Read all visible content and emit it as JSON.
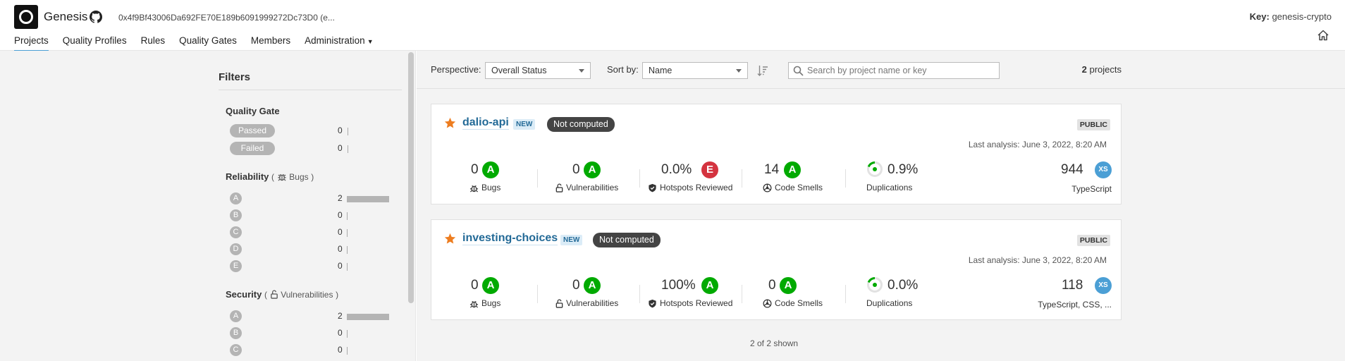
{
  "header": {
    "org_name": "Genesis",
    "org_key_id": "0x4f9Bf43006Da692FE70E189b6091999272Dc73D0 (e...",
    "key_label": "Key:",
    "key_value": "genesis-crypto",
    "icons": [
      "org-logo",
      "github-icon",
      "home-icon"
    ]
  },
  "nav": {
    "items": [
      {
        "label": "Projects",
        "active": true
      },
      {
        "label": "Quality Profiles"
      },
      {
        "label": "Rules"
      },
      {
        "label": "Quality Gates"
      },
      {
        "label": "Members"
      },
      {
        "label": "Administration",
        "has_dropdown": true
      }
    ]
  },
  "filters": {
    "title": "Filters",
    "quality_gate": {
      "title": "Quality Gate",
      "rows": [
        {
          "label": "Passed",
          "count": "0"
        },
        {
          "label": "Failed",
          "count": "0"
        }
      ]
    },
    "reliability": {
      "title": "Reliability",
      "sub_label": "Bugs",
      "rows": [
        {
          "label": "A",
          "count": "2",
          "fraction": 1
        },
        {
          "label": "B",
          "count": "0",
          "fraction": 0
        },
        {
          "label": "C",
          "count": "0",
          "fraction": 0
        },
        {
          "label": "D",
          "count": "0",
          "fraction": 0
        },
        {
          "label": "E",
          "count": "0",
          "fraction": 0
        }
      ]
    },
    "security": {
      "title": "Security",
      "sub_label": "Vulnerabilities",
      "rows": [
        {
          "label": "A",
          "count": "2",
          "fraction": 1
        },
        {
          "label": "B",
          "count": "0",
          "fraction": 0
        },
        {
          "label": "C",
          "count": "0",
          "fraction": 0
        }
      ]
    }
  },
  "toolbar": {
    "perspective_label": "Perspective:",
    "perspective_value": "Overall Status",
    "sort_label": "Sort by:",
    "sort_value": "Name",
    "search_placeholder": "Search by project name or key",
    "count_value": "2",
    "count_suffix": "projects"
  },
  "colors": {
    "rating_A": "#00aa00",
    "rating_E": "#d4333f",
    "accent_link": "#236a97",
    "favorite_star": "#ed7d20",
    "size_badge": "#4b9fd5"
  },
  "projects": [
    {
      "name": "dalio-api",
      "new_label": "NEW",
      "quality_gate": "Not computed",
      "visibility": "PUBLIC",
      "last_analysis": "Last analysis: June 3, 2022, 8:20 AM",
      "bugs": {
        "value": "0",
        "rating": "A",
        "label": "Bugs"
      },
      "vulnerabilities": {
        "value": "0",
        "rating": "A",
        "label": "Vulnerabilities"
      },
      "hotspots": {
        "value": "0.0%",
        "rating": "E",
        "label": "Hotspots Reviewed"
      },
      "code_smells": {
        "value": "14",
        "rating": "A",
        "label": "Code Smells"
      },
      "duplications": {
        "value": "0.9%",
        "label": "Duplications"
      },
      "size": {
        "value": "944",
        "badge": "XS",
        "languages": "TypeScript"
      }
    },
    {
      "name": "investing-choices",
      "new_label": "NEW",
      "quality_gate": "Not computed",
      "visibility": "PUBLIC",
      "last_analysis": "Last analysis: June 3, 2022, 8:20 AM",
      "bugs": {
        "value": "0",
        "rating": "A",
        "label": "Bugs"
      },
      "vulnerabilities": {
        "value": "0",
        "rating": "A",
        "label": "Vulnerabilities"
      },
      "hotspots": {
        "value": "100%",
        "rating": "A",
        "label": "Hotspots Reviewed"
      },
      "code_smells": {
        "value": "0",
        "rating": "A",
        "label": "Code Smells"
      },
      "duplications": {
        "value": "0.0%",
        "label": "Duplications"
      },
      "size": {
        "value": "118",
        "badge": "XS",
        "languages": "TypeScript, CSS, ..."
      }
    }
  ],
  "footer": {
    "shown": "2 of 2 shown"
  }
}
